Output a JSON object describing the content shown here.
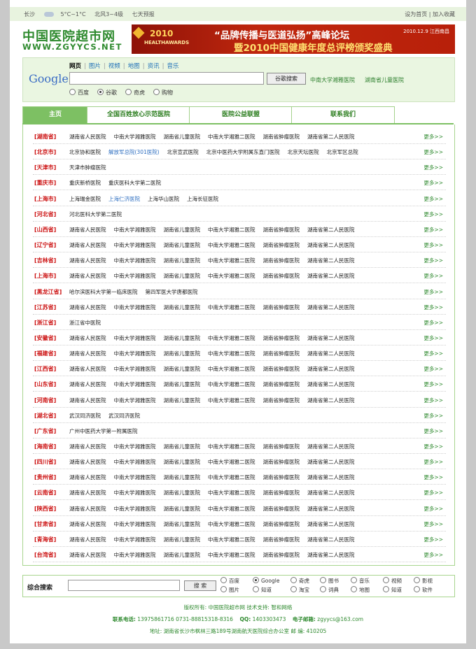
{
  "topbar": {
    "city": "长沙",
    "weather_icon": "cloud-icon",
    "temp": "5°C~1°C",
    "wind": "北风3~4级",
    "forecast": "七天预报",
    "set_home": "设为首页",
    "sep": "|",
    "add_fav": "加入收藏"
  },
  "logo": {
    "cn": "中国医院超市网",
    "en": "WWW.ZGYYCS.NET"
  },
  "banner": {
    "year": "2010",
    "award": "HEALTHAWARDS",
    "line1": "“品牌传播与医道弘扬”高峰论坛",
    "line2": "暨2010中国健康年度总评榜颁奖盛典",
    "date": "2010.12.9 江西南昌"
  },
  "search": {
    "logo": "Google",
    "tabs": [
      "网页",
      "图片",
      "视频",
      "地图",
      "资讯",
      "音乐"
    ],
    "active_tab": 0,
    "input_value": "",
    "button": "谷歌搜索",
    "quick_links": [
      "中南大学湘雅医院",
      "湖南省儿童医院"
    ],
    "radios": [
      "百度",
      "谷歌",
      "奇虎",
      "购物"
    ],
    "selected_radio": 1
  },
  "nav": {
    "tabs": [
      "主页",
      "全国百姓放心示范医院",
      "医院公益联盟",
      "联系我们"
    ],
    "active": 0
  },
  "more_label": "更多>>",
  "provinces": [
    {
      "name": "[湖南省]",
      "links": [
        "湖南省人民医院",
        "中南大学湘雅医院",
        "湖南省儿童医院",
        "中南大学湘雅二医院",
        "湖南省肿瘤医院",
        "湖南省第二人民医院"
      ]
    },
    {
      "name": "[北京市]",
      "links": [
        "北京协和医院",
        "解放军总院(301医院)",
        "北京宣武医院",
        "北京中医药大学附属东直门医院",
        "北京天坛医院",
        "北京军区总院"
      ],
      "blue": [
        1
      ]
    },
    {
      "name": "[天津市]",
      "links": [
        "天津市肿瘤医院"
      ]
    },
    {
      "name": "[重庆市]",
      "links": [
        "重庆新桥医院",
        "重庆医科大学第二医院"
      ]
    },
    {
      "name": "[上海市]",
      "links": [
        "上海瑞金医院",
        "上海仁济医院",
        "上海华山医院",
        "上海长征医院"
      ],
      "blue": [
        1
      ]
    },
    {
      "name": "[河北省]",
      "links": [
        "河北医科大学第二医院"
      ]
    },
    {
      "name": "[山西省]",
      "links": [
        "湖南省人民医院",
        "中南大学湘雅医院",
        "湖南省儿童医院",
        "中南大学湘雅二医院",
        "湖南省肿瘤医院",
        "湖南省第二人民医院"
      ]
    },
    {
      "name": "[辽宁省]",
      "links": [
        "湖南省人民医院",
        "中南大学湘雅医院",
        "湖南省儿童医院",
        "中南大学湘雅二医院",
        "湖南省肿瘤医院",
        "湖南省第二人民医院"
      ]
    },
    {
      "name": "[吉林省]",
      "links": [
        "湖南省人民医院",
        "中南大学湘雅医院",
        "湖南省儿童医院",
        "中南大学湘雅二医院",
        "湖南省肿瘤医院",
        "湖南省第二人民医院"
      ]
    },
    {
      "name": "[上海市]",
      "links": [
        "湖南省人民医院",
        "中南大学湘雅医院",
        "湖南省儿童医院",
        "中南大学湘雅二医院",
        "湖南省肿瘤医院",
        "湖南省第二人民医院"
      ]
    },
    {
      "name": "[黑龙江省]",
      "links": [
        "哈尔滨医科大学第一临床医院",
        "第四军医大学唐都医院"
      ]
    },
    {
      "name": "[江苏省]",
      "links": [
        "湖南省人民医院",
        "中南大学湘雅医院",
        "湖南省儿童医院",
        "中南大学湘雅二医院",
        "湖南省肿瘤医院",
        "湖南省第二人民医院"
      ]
    },
    {
      "name": "[浙江省]",
      "links": [
        "浙江省中医院"
      ]
    },
    {
      "name": "[安徽省]",
      "links": [
        "湖南省人民医院",
        "中南大学湘雅医院",
        "湖南省儿童医院",
        "中南大学湘雅二医院",
        "湖南省肿瘤医院",
        "湖南省第二人民医院"
      ]
    },
    {
      "name": "[福建省]",
      "links": [
        "湖南省人民医院",
        "中南大学湘雅医院",
        "湖南省儿童医院",
        "中南大学湘雅二医院",
        "湖南省肿瘤医院",
        "湖南省第二人民医院"
      ]
    },
    {
      "name": "[江西省]",
      "links": [
        "湖南省人民医院",
        "中南大学湘雅医院",
        "湖南省儿童医院",
        "中南大学湘雅二医院",
        "湖南省肿瘤医院",
        "湖南省第二人民医院"
      ]
    },
    {
      "name": "[山东省]",
      "links": [
        "湖南省人民医院",
        "中南大学湘雅医院",
        "湖南省儿童医院",
        "中南大学湘雅二医院",
        "湖南省肿瘤医院",
        "湖南省第二人民医院"
      ]
    },
    {
      "name": "[河南省]",
      "links": [
        "湖南省人民医院",
        "中南大学湘雅医院",
        "湖南省儿童医院",
        "中南大学湘雅二医院",
        "湖南省肿瘤医院",
        "湖南省第二人民医院"
      ]
    },
    {
      "name": "[湖北省]",
      "links": [
        "武汉同济医院",
        "武汉同济医院"
      ]
    },
    {
      "name": "[广东省]",
      "links": [
        "广州中医药大学第一附属医院"
      ]
    },
    {
      "name": "[海南省]",
      "links": [
        "湖南省人民医院",
        "中南大学湘雅医院",
        "湖南省儿童医院",
        "中南大学湘雅二医院",
        "湖南省肿瘤医院",
        "湖南省第二人民医院"
      ]
    },
    {
      "name": "[四川省]",
      "links": [
        "湖南省人民医院",
        "中南大学湘雅医院",
        "湖南省儿童医院",
        "中南大学湘雅二医院",
        "湖南省肿瘤医院",
        "湖南省第二人民医院"
      ]
    },
    {
      "name": "[贵州省]",
      "links": [
        "湖南省人民医院",
        "中南大学湘雅医院",
        "湖南省儿童医院",
        "中南大学湘雅二医院",
        "湖南省肿瘤医院",
        "湖南省第二人民医院"
      ]
    },
    {
      "name": "[云南省]",
      "links": [
        "湖南省人民医院",
        "中南大学湘雅医院",
        "湖南省儿童医院",
        "中南大学湘雅二医院",
        "湖南省肿瘤医院",
        "湖南省第二人民医院"
      ]
    },
    {
      "name": "[陕西省]",
      "links": [
        "湖南省人民医院",
        "中南大学湘雅医院",
        "湖南省儿童医院",
        "中南大学湘雅二医院",
        "湖南省肿瘤医院",
        "湖南省第二人民医院"
      ]
    },
    {
      "name": "[甘肃省]",
      "links": [
        "湖南省人民医院",
        "中南大学湘雅医院",
        "湖南省儿童医院",
        "中南大学湘雅二医院",
        "湖南省肿瘤医院",
        "湖南省第二人民医院"
      ]
    },
    {
      "name": "[青海省]",
      "links": [
        "湖南省人民医院",
        "中南大学湘雅医院",
        "湖南省儿童医院",
        "中南大学湘雅二医院",
        "湖南省肿瘤医院",
        "湖南省第二人民医院"
      ]
    },
    {
      "name": "[台湾省]",
      "links": [
        "湖南省人民医院",
        "中南大学湘雅医院",
        "湖南省儿童医院",
        "中南大学湘雅二医院",
        "湖南省肿瘤医院",
        "湖南省第二人民医院"
      ]
    }
  ],
  "bottom_search": {
    "label": "综合搜索",
    "input_value": "",
    "button": "搜 索",
    "options_row1": [
      "百度",
      "Google",
      "奇虎",
      "图书",
      "音乐",
      "视频",
      "影视"
    ],
    "options_row2": [
      "图片",
      "知道",
      "淘宝",
      "词典",
      "地图",
      "知道",
      "软件"
    ],
    "selected": "Google"
  },
  "footer": {
    "copyright": "版权所有: 中国医院超市网  技术支持: 智和网络",
    "phone_label": "联系电话:",
    "phone": "13975861716  0731-88815318-8316",
    "qq_label": "QQ:",
    "qq": "1403303473",
    "email_label": "电子邮箱:",
    "email": "zgyycs@163.com",
    "address": "地址: 湖南省长沙市枫林三路189号湖南航天医院综合办公室    邮 编: 410205"
  },
  "colors": {
    "brand_green": "#2e8a2e",
    "province_red": "#cc1111",
    "link_blue": "#2f6fc0",
    "nav_active": "#7dc063"
  }
}
